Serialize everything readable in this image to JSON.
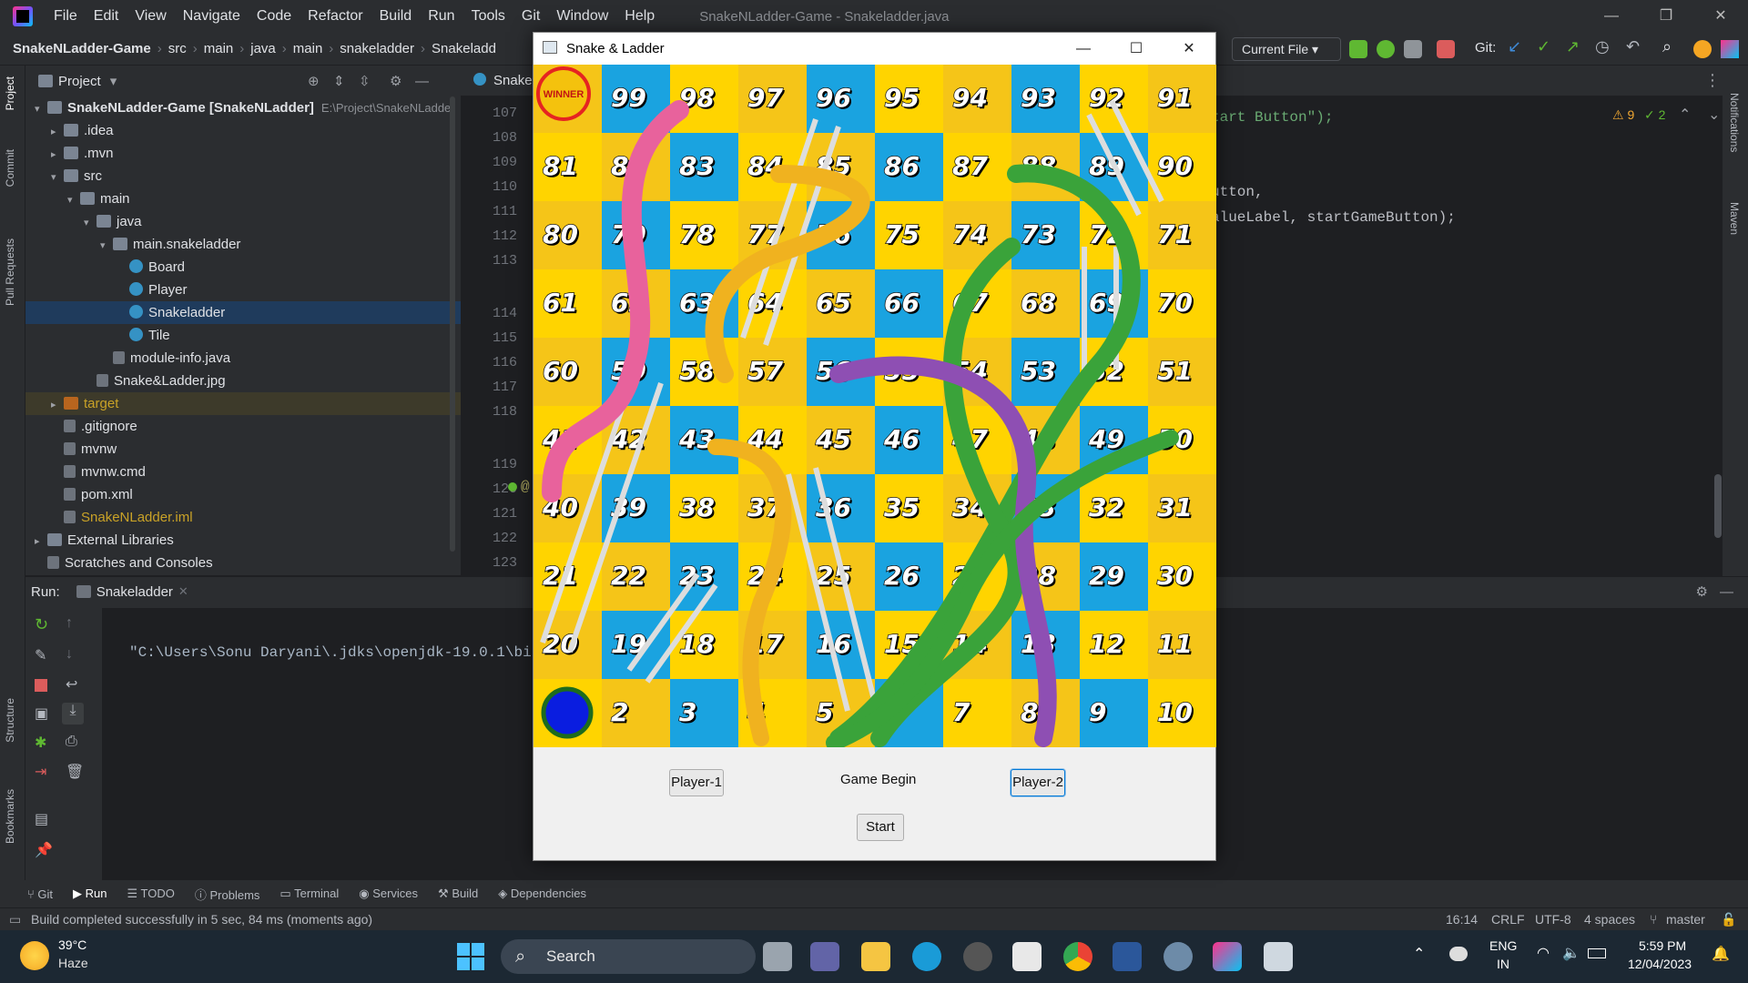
{
  "menubar": {
    "items": [
      "File",
      "Edit",
      "View",
      "Navigate",
      "Code",
      "Refactor",
      "Build",
      "Run",
      "Tools",
      "Git",
      "Window",
      "Help"
    ],
    "title": "SnakeNLadder-Game - Snakeladder.java"
  },
  "navbar": {
    "crumbs": [
      "SnakeNLadder-Game",
      "src",
      "main",
      "java",
      "main",
      "snakeladder",
      "Snakeladd"
    ],
    "run_config": "Current File",
    "git_label": "Git:"
  },
  "project_panel": {
    "title": "Project",
    "tree": [
      {
        "label": "SnakeNLadder-Game [SnakeNLadder]",
        "extra": "E:\\Project\\SnakeNLadde",
        "level": 0,
        "arrow": "▾",
        "icon": "folder",
        "color": "#dfe1e5"
      },
      {
        "label": ".idea",
        "level": 1,
        "arrow": "▸",
        "icon": "folder",
        "color": "#dfe1e5"
      },
      {
        "label": ".mvn",
        "level": 1,
        "arrow": "▸",
        "icon": "folder",
        "color": "#dfe1e5"
      },
      {
        "label": "src",
        "level": 1,
        "arrow": "▾",
        "icon": "folder",
        "color": "#dfe1e5"
      },
      {
        "label": "main",
        "level": 2,
        "arrow": "▾",
        "icon": "folder",
        "color": "#dfe1e5"
      },
      {
        "label": "java",
        "level": 3,
        "arrow": "▾",
        "icon": "folder",
        "color": "#dfe1e5"
      },
      {
        "label": "main.snakeladder",
        "level": 4,
        "arrow": "▾",
        "icon": "folder",
        "color": "#dfe1e5"
      },
      {
        "label": "Board",
        "level": 5,
        "arrow": "",
        "icon": "cls",
        "color": "#dfe1e5"
      },
      {
        "label": "Player",
        "level": 5,
        "arrow": "",
        "icon": "cls",
        "color": "#dfe1e5"
      },
      {
        "label": "Snakeladder",
        "level": 5,
        "arrow": "",
        "icon": "cls",
        "color": "#dfe1e5",
        "selected": true
      },
      {
        "label": "Tile",
        "level": 5,
        "arrow": "",
        "icon": "cls",
        "color": "#dfe1e5"
      },
      {
        "label": "module-info.java",
        "level": 4,
        "arrow": "",
        "icon": "file",
        "color": "#dfe1e5"
      },
      {
        "label": "Snake&Ladder.jpg",
        "level": 3,
        "arrow": "",
        "icon": "file",
        "color": "#dfe1e5"
      },
      {
        "label": "target",
        "level": 1,
        "arrow": "▸",
        "icon": "folder",
        "color": "#c9a227",
        "target": true
      },
      {
        "label": ".gitignore",
        "level": 1,
        "arrow": "",
        "icon": "file",
        "color": "#dfe1e5"
      },
      {
        "label": "mvnw",
        "level": 1,
        "arrow": "",
        "icon": "file",
        "color": "#dfe1e5"
      },
      {
        "label": "mvnw.cmd",
        "level": 1,
        "arrow": "",
        "icon": "file",
        "color": "#dfe1e5"
      },
      {
        "label": "pom.xml",
        "level": 1,
        "arrow": "",
        "icon": "file",
        "color": "#dfe1e5"
      },
      {
        "label": "SnakeNLadder.iml",
        "level": 1,
        "arrow": "",
        "icon": "file",
        "color": "#c9a227"
      },
      {
        "label": "External Libraries",
        "level": 0,
        "arrow": "▸",
        "icon": "folder",
        "color": "#dfe1e5"
      },
      {
        "label": "Scratches and Consoles",
        "level": 0,
        "arrow": "",
        "icon": "file",
        "color": "#dfe1e5"
      }
    ]
  },
  "editor": {
    "tab_label": "Snake",
    "line_numbers": [
      "107",
      "108",
      "109",
      "110",
      "111",
      "112",
      "113",
      "114",
      "115",
      "116",
      "117",
      "118",
      "119",
      "120",
      "121",
      "122",
      "123"
    ],
    "code_lines": [
      "tart Button\");",
      "utton,",
      "alueLabel, startGameButton);"
    ],
    "inspection_warnings": "9",
    "inspection_ok": "2",
    "gutter_marker": "@"
  },
  "run_panel": {
    "label": "Run:",
    "tab": "Snakeladder",
    "console_text": "\"C:\\Users\\Sonu Daryani\\.jdks\\openjdk-19.0.1\\bin"
  },
  "tool_tabs": [
    "Git",
    "Run",
    "TODO",
    "Problems",
    "Terminal",
    "Services",
    "Build",
    "Dependencies"
  ],
  "status": {
    "message": "Build completed successfully in 5 sec, 84 ms (moments ago)",
    "position": "16:14",
    "line_sep": "CRLF",
    "encoding": "UTF-8",
    "indent": "4 spaces",
    "branch": "master"
  },
  "right_stripe": [
    "Notifications",
    "Maven"
  ],
  "left_stripe": [
    "Project",
    "Commit",
    "Pull Requests",
    "Structure",
    "Bookmarks"
  ],
  "game": {
    "title": "Snake & Ladder",
    "winner_badge": "WINNER",
    "player1_button": "Player-1",
    "player2_button": "Player-2",
    "status_label": "Game Begin",
    "start_button": "Start",
    "board_colors": [
      "#f5c518",
      "#e52421",
      "#1aa3e0",
      "#8dc63f",
      "#ffd400",
      "#f08a1c"
    ],
    "player_token_color": "#0a1de0"
  },
  "taskbar": {
    "weather_temp": "39°C",
    "weather_desc": "Haze",
    "search": "Search",
    "lang1": "ENG",
    "lang2": "IN",
    "time": "5:59 PM",
    "date": "12/04/2023"
  }
}
